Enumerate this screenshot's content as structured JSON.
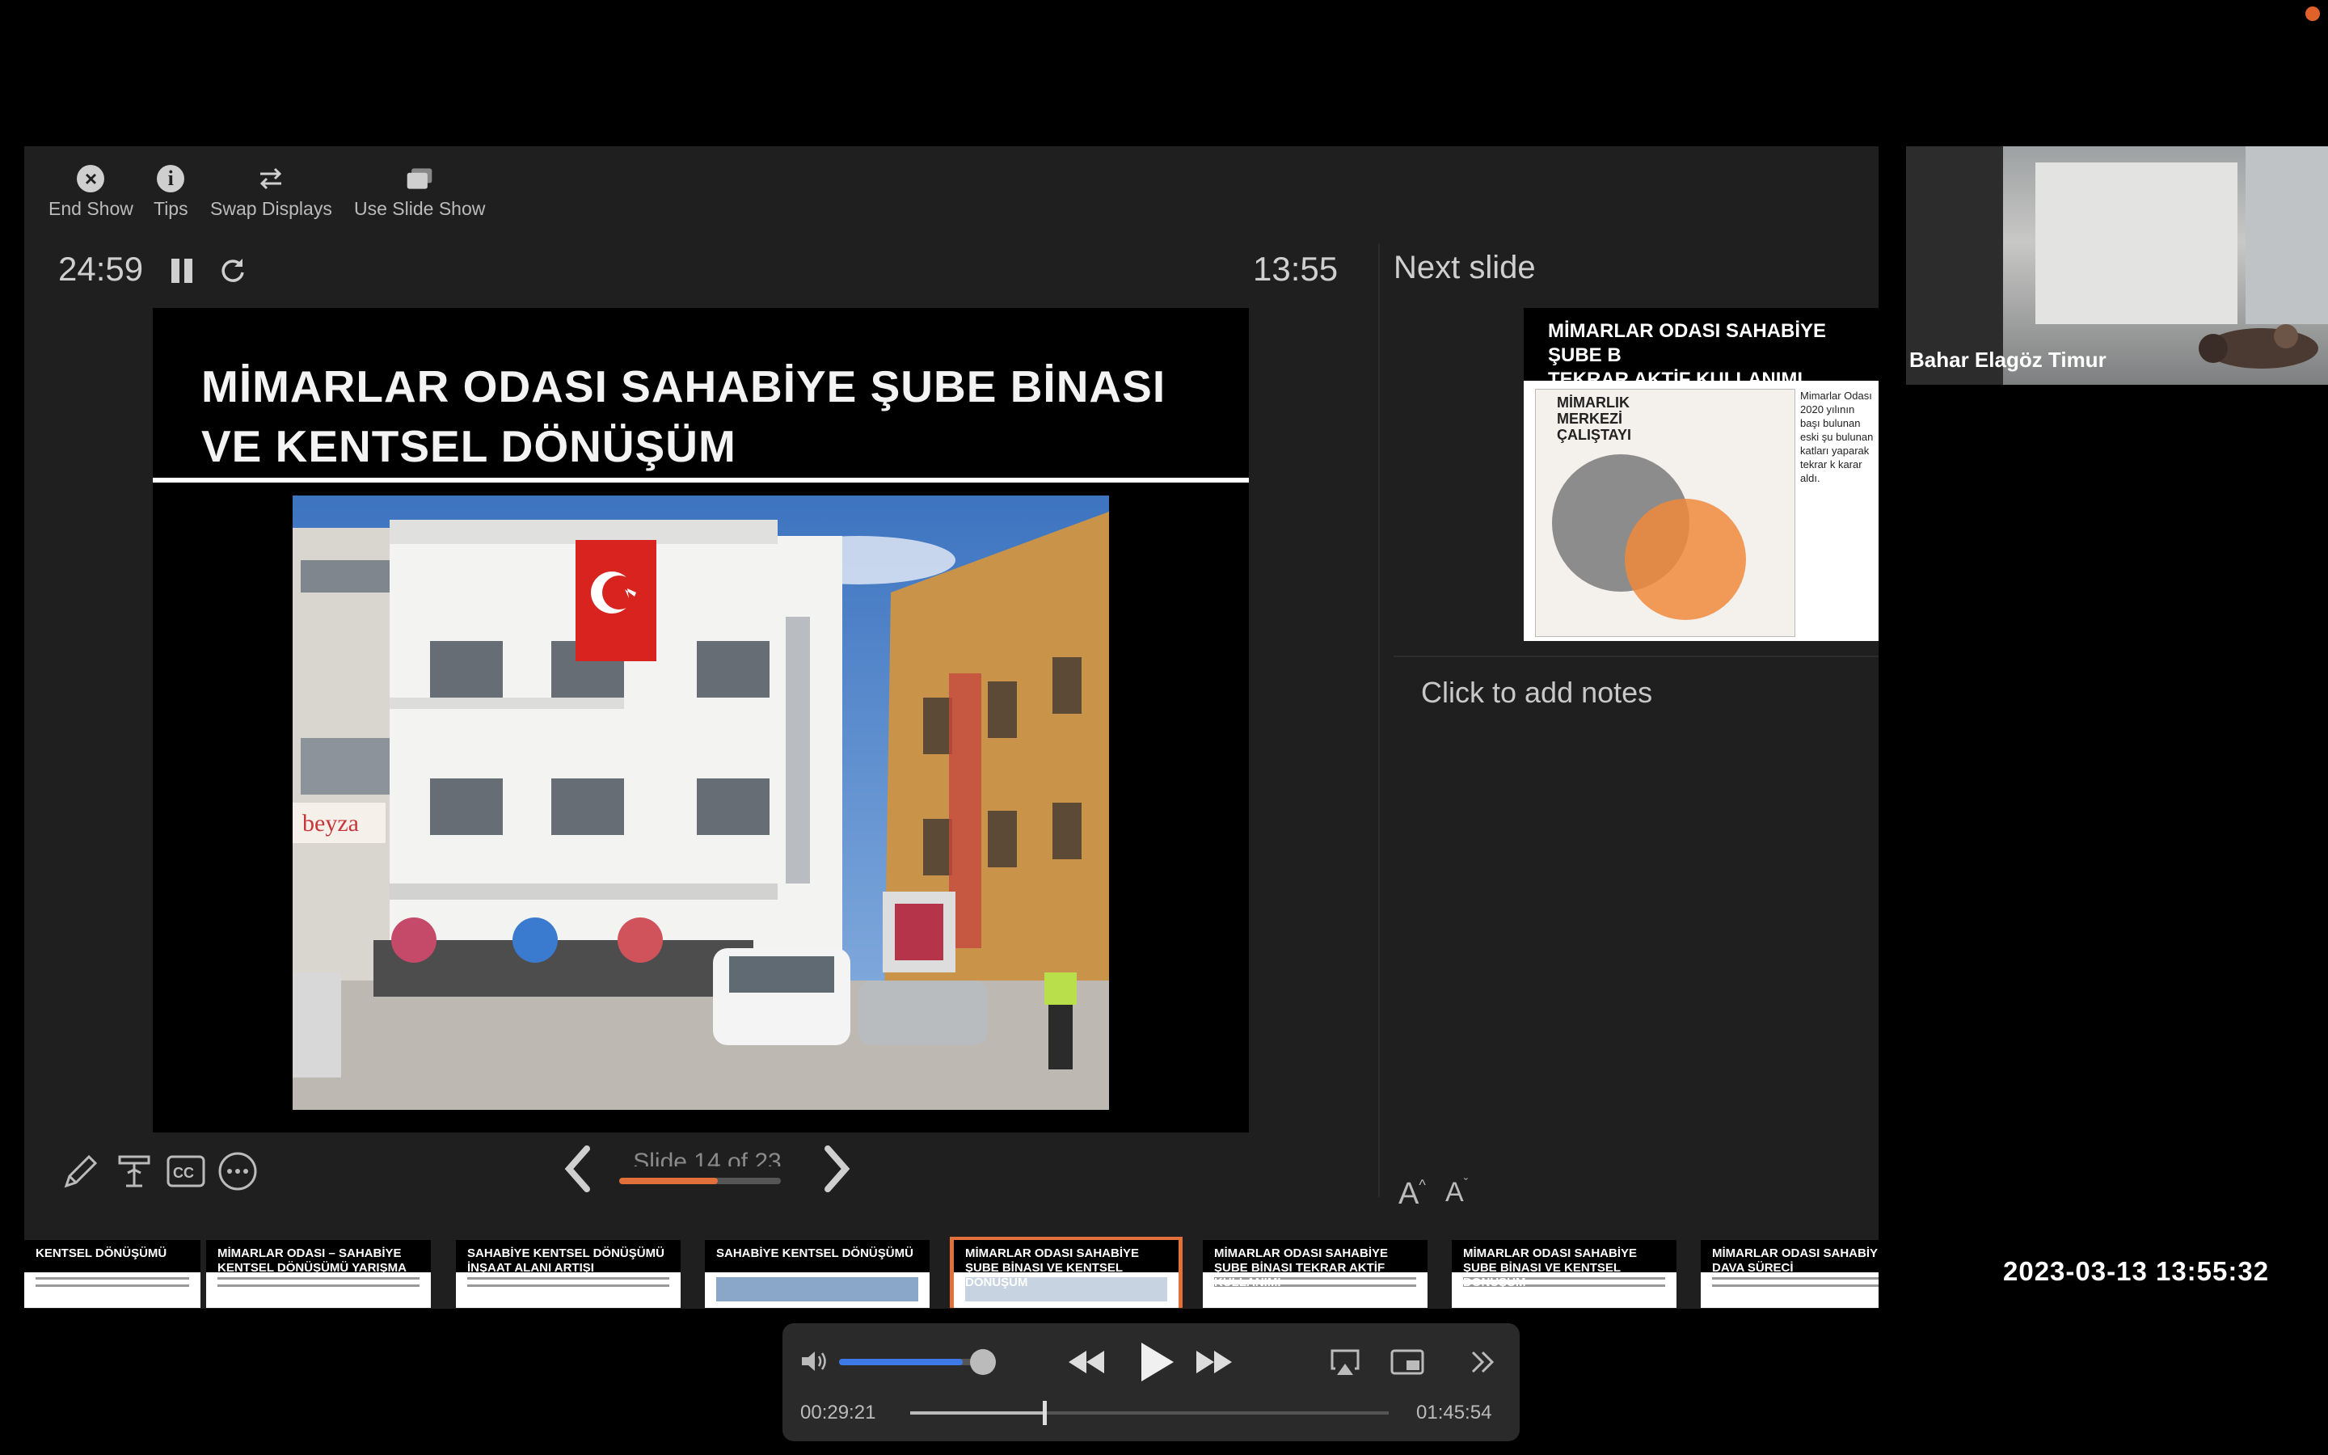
{
  "toolbar": {
    "end_show": "End Show",
    "tips": "Tips",
    "swap_displays": "Swap Displays",
    "use_slide_show": "Use Slide Show"
  },
  "timer": "24:59",
  "clock": "13:55",
  "current_slide": {
    "title_line1": "MİMARLAR ODASI SAHABİYE ŞUBE BİNASI",
    "title_line2": "VE KENTSEL DÖNÜŞÜM",
    "sign_text": "beyza"
  },
  "navigation": {
    "counter": "Slide 14 of 23",
    "progress": 0.61
  },
  "next_slide": {
    "label": "Next slide",
    "title_line1": "MİMARLAR ODASI SAHABİYE ŞUBE B",
    "title_line2": "TEKRAR AKTİF KULLANIMI",
    "poster_title": "MİMARLIK MERKEZİ ÇALIŞTAYI",
    "side_text": "Mimarlar Odası 2020 yılının başı bulunan eski şu bulunan katları yaparak tekrar k karar aldı."
  },
  "notes_placeholder": "Click to add notes",
  "font_buttons": {
    "increase": "A",
    "decrease": "A"
  },
  "thumbnails": [
    {
      "title": "KENTSEL DÖNÜŞÜMÜ"
    },
    {
      "title": "MİMARLAR ODASI – SAHABİYE KENTSEL DÖNÜŞÜMÜ YARIŞMA"
    },
    {
      "title": "SAHABİYE KENTSEL DÖNÜŞÜMÜ İNŞAAT ALANI ARTIŞI"
    },
    {
      "title": "SAHABİYE KENTSEL DÖNÜŞÜMÜ"
    },
    {
      "title": "MİMARLAR ODASI SAHABİYE ŞUBE BİNASI VE KENTSEL DÖNÜŞÜM"
    },
    {
      "title": "MİMARLAR ODASI SAHABİYE ŞUBE BİNASI TEKRAR AKTİF KULLANIMI"
    },
    {
      "title": "MİMARLAR ODASI SAHABİYE ŞUBE BİNASI VE KENTSEL DÖNÜŞÜM"
    },
    {
      "title": "MİMARLAR ODASI SAHABİYE Ş DAVA SÜRECİ"
    }
  ],
  "active_thumbnail": 4,
  "participant": {
    "name": "Bahar Elagöz Timur"
  },
  "timestamp": "2023-03-13  13:55:32",
  "player": {
    "elapsed": "00:29:21",
    "total": "01:45:54",
    "volume": 0.85,
    "position": 0.28
  },
  "colors": {
    "accent": "#e2703a",
    "volume": "#3d7ae8"
  }
}
